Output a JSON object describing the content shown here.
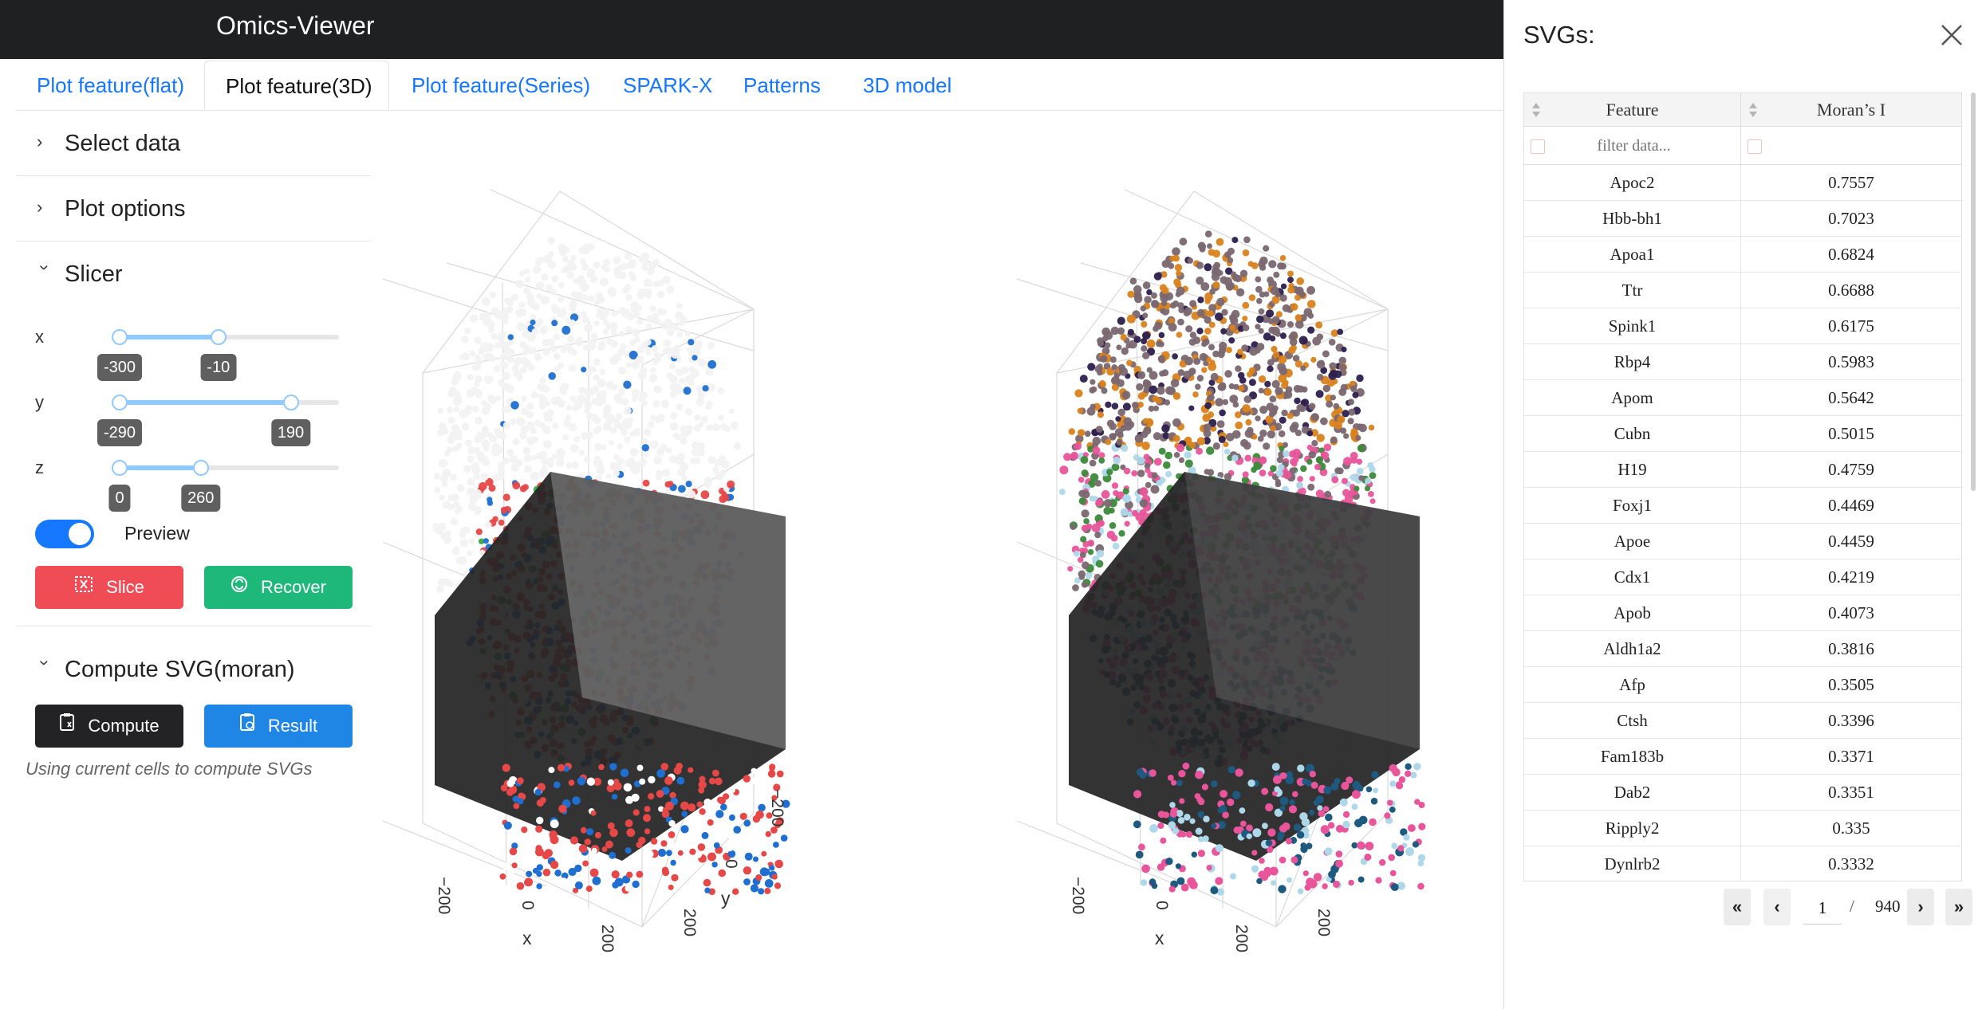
{
  "app": {
    "title": "Omics-Viewer"
  },
  "tabs": [
    {
      "label": "Plot feature(flat)",
      "active": false
    },
    {
      "label": "Plot feature(3D)",
      "active": true
    },
    {
      "label": "Plot feature(Series)",
      "active": false
    },
    {
      "label": "SPARK-X",
      "active": false
    },
    {
      "label": "Patterns",
      "active": false
    },
    {
      "label": "3D model",
      "active": false
    }
  ],
  "left_panel": {
    "sections": {
      "select_data": "Select data",
      "plot_options": "Plot options",
      "slicer": "Slicer",
      "compute_svg": "Compute SVG(moran)"
    },
    "slicer": {
      "range": [
        -400,
        400
      ],
      "sliders": [
        {
          "axis": "x",
          "low": "-300",
          "high": "-10",
          "low_frac": 0.0,
          "high_frac": 0.45
        },
        {
          "axis": "y",
          "low": "-290",
          "high": "190",
          "low_frac": 0.0,
          "high_frac": 0.78
        },
        {
          "axis": "z",
          "low": "0",
          "high": "260",
          "low_frac": 0.0,
          "high_frac": 0.37
        }
      ],
      "preview_label": "Preview",
      "preview_on": true,
      "slice_label": "Slice",
      "recover_label": "Recover"
    },
    "compute": {
      "compute_label": "Compute",
      "result_label": "Result",
      "hint": "Using current cells to compute SVGs"
    }
  },
  "plots": {
    "left": {
      "x_axis_title": "x",
      "y_axis_title": "y",
      "x_ticks": [
        "−200",
        "0",
        "200"
      ],
      "y_ticks": [
        "200",
        "0",
        "−200"
      ]
    },
    "right": {
      "x_axis_title": "x",
      "x_ticks": [
        "−200",
        "0",
        "200"
      ],
      "y_ticks": [
        "200"
      ]
    },
    "colors": {
      "left_points": [
        "#e64848",
        "#1f6fd1",
        "#3aa845",
        "#f2f2f2",
        "#ffffff"
      ],
      "right_points": [
        "#7a6770",
        "#d9821e",
        "#e8559a",
        "#1e5a80",
        "#aed8ea",
        "#3b8a3a",
        "#2d1f4d"
      ],
      "slice_box": "#232323"
    }
  },
  "drawer": {
    "title": "SVGs:",
    "columns": [
      "Feature",
      "Moran’s I"
    ],
    "filter_placeholder": "filter data...",
    "rows": [
      [
        "Apoc2",
        "0.7557"
      ],
      [
        "Hbb-bh1",
        "0.7023"
      ],
      [
        "Apoa1",
        "0.6824"
      ],
      [
        "Ttr",
        "0.6688"
      ],
      [
        "Spink1",
        "0.6175"
      ],
      [
        "Rbp4",
        "0.5983"
      ],
      [
        "Apom",
        "0.5642"
      ],
      [
        "Cubn",
        "0.5015"
      ],
      [
        "H19",
        "0.4759"
      ],
      [
        "Foxj1",
        "0.4469"
      ],
      [
        "Apoe",
        "0.4459"
      ],
      [
        "Cdx1",
        "0.4219"
      ],
      [
        "Apob",
        "0.4073"
      ],
      [
        "Aldh1a2",
        "0.3816"
      ],
      [
        "Afp",
        "0.3505"
      ],
      [
        "Ctsh",
        "0.3396"
      ],
      [
        "Fam183b",
        "0.3371"
      ],
      [
        "Dab2",
        "0.3351"
      ],
      [
        "Ripply2",
        "0.335"
      ],
      [
        "Dynlrb2",
        "0.3332"
      ]
    ],
    "pagination": {
      "current": "1",
      "separator": "/",
      "total": "940"
    }
  }
}
